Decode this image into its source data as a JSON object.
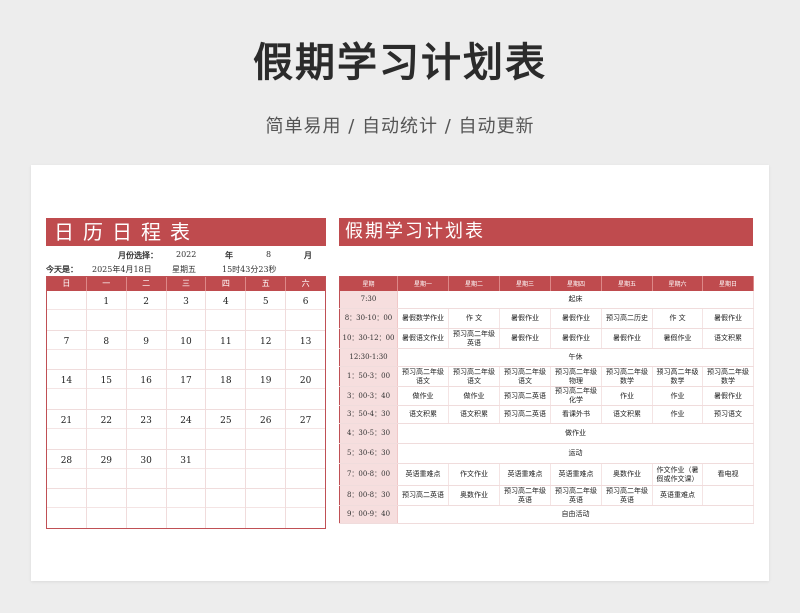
{
  "page": {
    "title": "假期学习计划表",
    "subtitle": "简单易用  /  自动统计  /  自动更新"
  },
  "calendar": {
    "header": "日历日程表",
    "month_select_label": "月份选择：",
    "year": "2022",
    "year_unit": "年",
    "month": "8",
    "month_unit": "月",
    "today_label": "今天是：",
    "today_date": "2025年4月18日",
    "today_weekday": "星期五",
    "today_time": "15时43分23秒",
    "weekdays": [
      "日",
      "一",
      "二",
      "三",
      "四",
      "五",
      "六"
    ],
    "weeks": [
      [
        "",
        "1",
        "2",
        "3",
        "4",
        "5",
        "6"
      ],
      [
        "7",
        "8",
        "9",
        "10",
        "11",
        "12",
        "13"
      ],
      [
        "14",
        "15",
        "16",
        "17",
        "18",
        "19",
        "20"
      ],
      [
        "21",
        "22",
        "23",
        "24",
        "25",
        "26",
        "27"
      ],
      [
        "28",
        "29",
        "30",
        "31",
        "",
        "",
        ""
      ],
      [
        "",
        "",
        "",
        "",
        "",
        "",
        ""
      ]
    ]
  },
  "plan": {
    "header": "假期学习计划表",
    "columns": [
      "星期",
      "星期一",
      "星期二",
      "星期三",
      "星期四",
      "星期五",
      "星期六",
      "星期日"
    ],
    "rows": [
      {
        "time": "7:30",
        "span": "起床"
      },
      {
        "time": "8：30-10：00",
        "cells": [
          "暑假数学作业",
          "作  文",
          "暑假作业",
          "暑假作业",
          "预习高二历史",
          "作  文",
          "暑假作业"
        ]
      },
      {
        "time": "10：30-12：00",
        "cells": [
          "暑假语文作业",
          "预习高二年级英语",
          "暑假作业",
          "暑假作业",
          "暑假作业",
          "暑假作业",
          "语文积累"
        ]
      },
      {
        "time": "12:30-1:30",
        "span": "午休"
      },
      {
        "time": "1：50-3：00",
        "cells": [
          "预习高二年级语文",
          "预习高二年级语文",
          "预习高二年级语文",
          "预习高二年级物理",
          "预习高二年级数学",
          "预习高二年级数学",
          "预习高二年级数学"
        ]
      },
      {
        "time": "3：00-3：40",
        "cells": [
          "做作业",
          "做作业",
          "预习高二英语",
          "预习高二年级化学",
          "作业",
          "作业",
          "暑假作业"
        ]
      },
      {
        "time": "3：50-4：30",
        "cells": [
          "语文积累",
          "语文积累",
          "预习高二英语",
          "看课外书",
          "语文积累",
          "作业",
          "预习语文"
        ]
      },
      {
        "time": "4：30-5：30",
        "span": "做作业"
      },
      {
        "time": "5：30-6：30",
        "span": "运动"
      },
      {
        "time": "7：00-8：00",
        "cells": [
          "英语重难点",
          "作文作业",
          "英语重难点",
          "英语重难点",
          "奥数作业",
          "作文作业（暑假或作文课）",
          "看电视"
        ]
      },
      {
        "time": "8：00-8：30",
        "cells": [
          "预习高二英语",
          "奥数作业",
          "预习高二年级英语",
          "预习高二年级英语",
          "预习高二年级英语",
          "英语重难点",
          ""
        ]
      },
      {
        "time": "9：00-9：40",
        "span": "自由活动"
      }
    ]
  }
}
